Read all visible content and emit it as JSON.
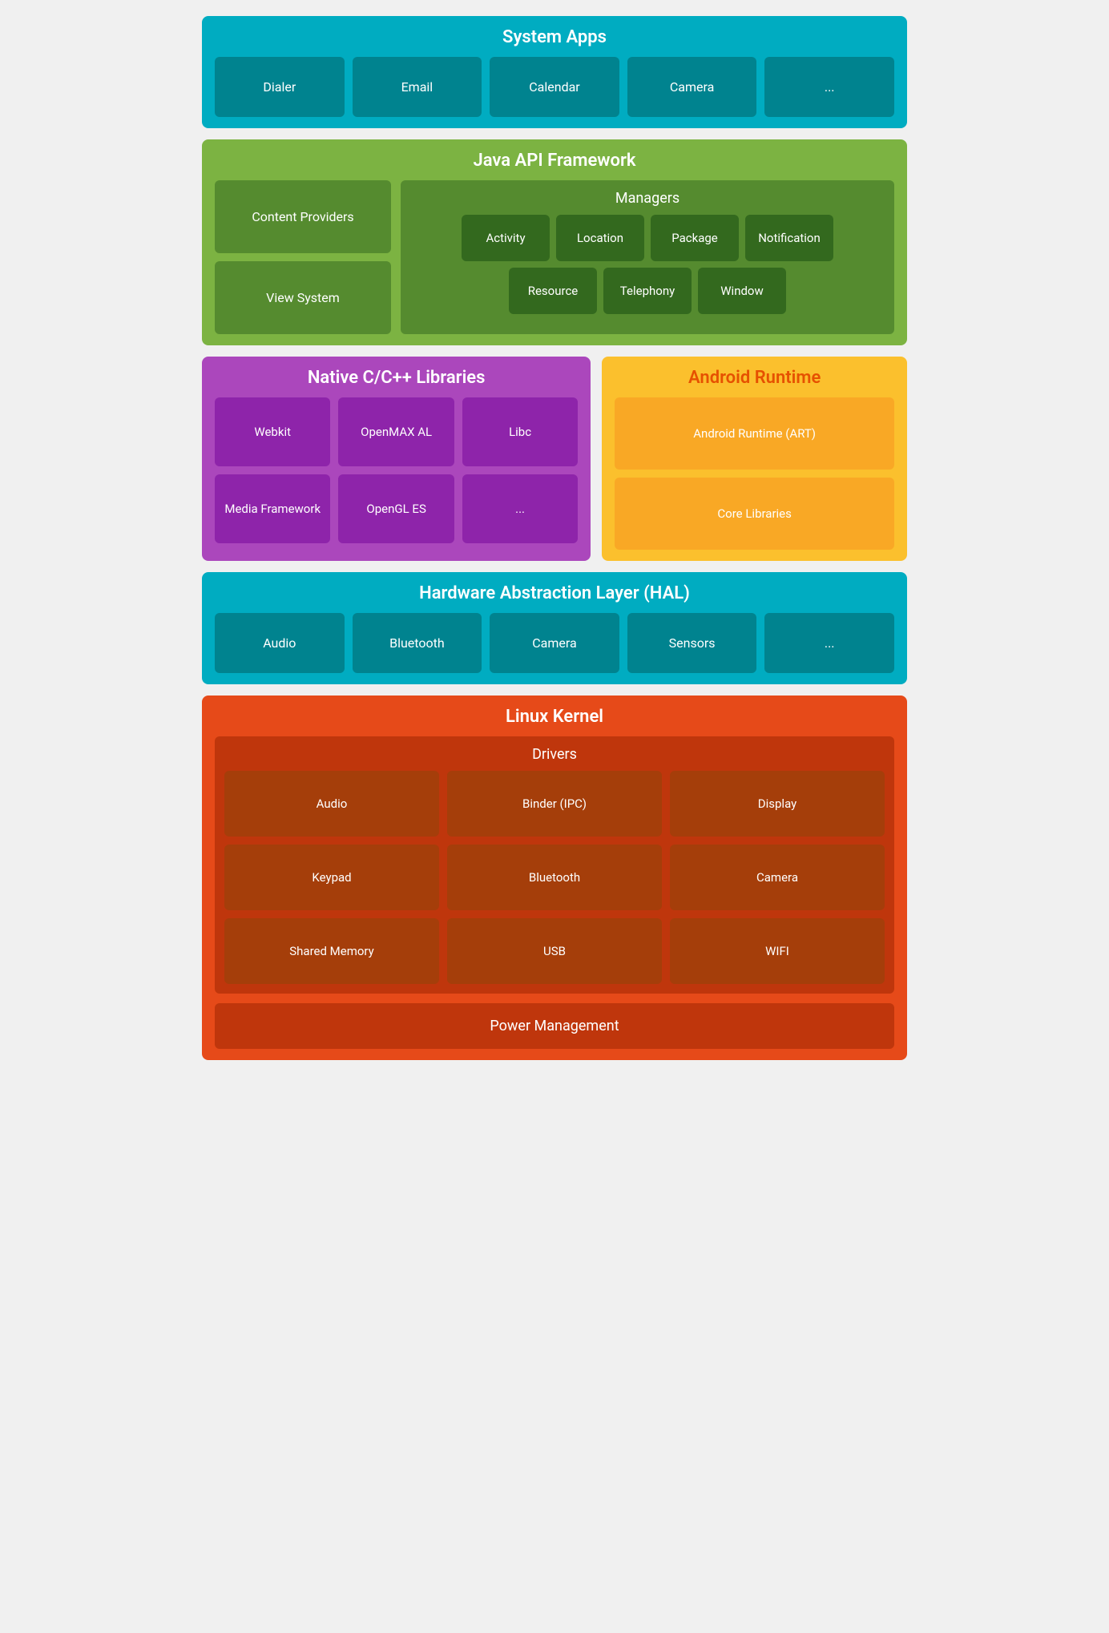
{
  "systemApps": {
    "title": "System Apps",
    "items": [
      "Dialer",
      "Email",
      "Calendar",
      "Camera",
      "..."
    ]
  },
  "javaApi": {
    "title": "Java API Framework",
    "left": [
      "Content Providers",
      "View System"
    ],
    "managers": {
      "title": "Managers",
      "rows": [
        [
          "Activity",
          "Location",
          "Package",
          "Notification"
        ],
        [
          "Resource",
          "Telephony",
          "Window"
        ]
      ]
    }
  },
  "nativeLibs": {
    "title": "Native C/C++ Libraries",
    "items": [
      "Webkit",
      "OpenMAX AL",
      "Libc",
      "Media Framework",
      "OpenGL ES",
      "..."
    ]
  },
  "androidRuntime": {
    "title": "Android Runtime",
    "items": [
      "Android Runtime (ART)",
      "Core Libraries"
    ]
  },
  "hal": {
    "title": "Hardware Abstraction Layer (HAL)",
    "items": [
      "Audio",
      "Bluetooth",
      "Camera",
      "Sensors",
      "..."
    ]
  },
  "linuxKernel": {
    "title": "Linux Kernel",
    "drivers": {
      "title": "Drivers",
      "items": [
        "Audio",
        "Binder (IPC)",
        "Display",
        "Keypad",
        "Bluetooth",
        "Camera",
        "Shared Memory",
        "USB",
        "WIFI"
      ]
    },
    "powerManagement": "Power Management"
  }
}
